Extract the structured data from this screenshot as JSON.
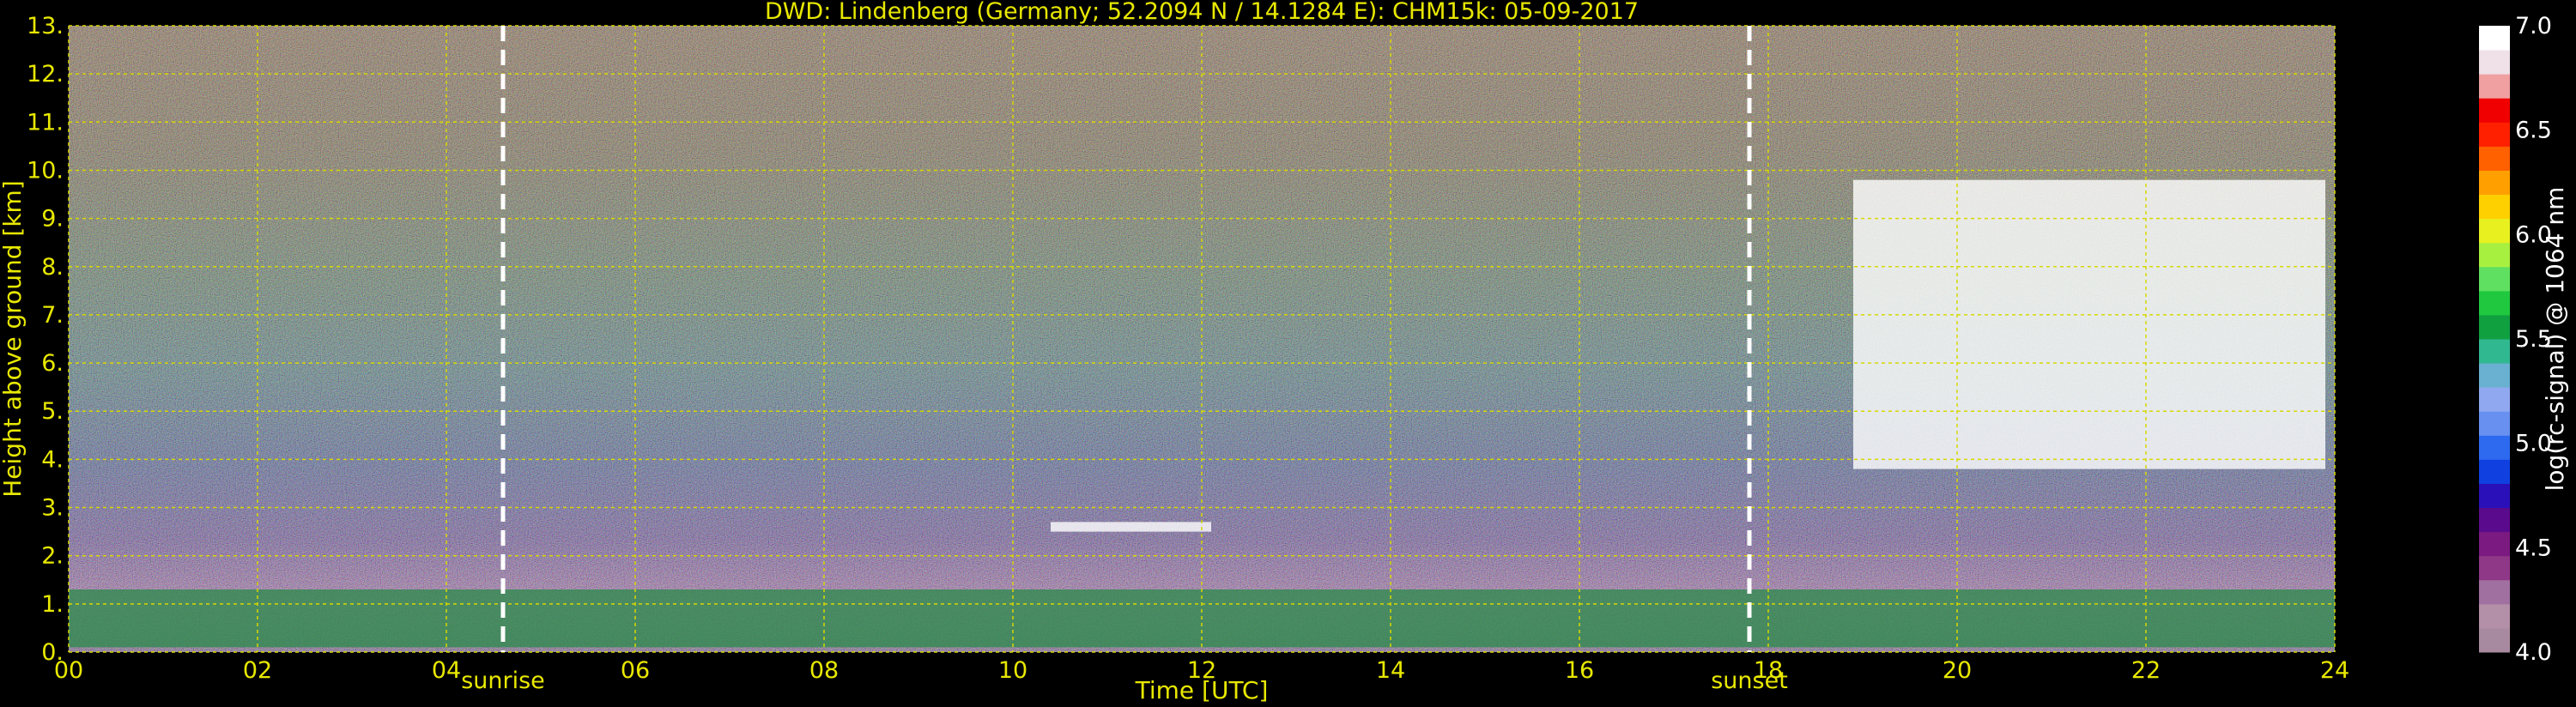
{
  "chart_data": {
    "type": "heatmap",
    "title": "DWD: Lindenberg (Germany; 52.2094 N / 14.1284 E):     CHM15k: 05-09-2017",
    "xlabel": "Time [UTC]",
    "ylabel": "Height above ground [km]",
    "xlim": [
      0,
      24
    ],
    "ylim": [
      0,
      13
    ],
    "x_ticks": [
      "00",
      "02",
      "04",
      "06",
      "08",
      "10",
      "12",
      "14",
      "16",
      "18",
      "20",
      "22",
      "24"
    ],
    "y_ticks": [
      "0.",
      "1.",
      "2.",
      "3.",
      "4.",
      "5.",
      "6.",
      "7.",
      "8.",
      "9.",
      "10.",
      "11.",
      "12.",
      "13."
    ],
    "grid": true,
    "colorbar": {
      "label": "log(rc-signal) @ 1064 nm",
      "range": [
        4.0,
        7.0
      ],
      "ticks": [
        "4.0",
        "4.5",
        "5.0",
        "5.5",
        "6.0",
        "6.5",
        "7.0"
      ],
      "colors": [
        "#a88aa0",
        "#b48fa8",
        "#a070a0",
        "#903888",
        "#7b1a80",
        "#5a0a8c",
        "#2a10b8",
        "#1040e0",
        "#2e6af0",
        "#6890f0",
        "#90a8f0",
        "#6ab0d0",
        "#30b890",
        "#10a040",
        "#20c840",
        "#60e060",
        "#a8f040",
        "#e8f020",
        "#ffd000",
        "#ffa000",
        "#ff6000",
        "#ff2000",
        "#f00000",
        "#f0a0a0",
        "#f0e0e8",
        "#ffffff"
      ]
    },
    "markers": [
      {
        "label": "sunrise",
        "x": 4.6
      },
      {
        "label": "sunset",
        "x": 17.8
      }
    ],
    "layers": [
      {
        "name": "boundary layer (near surface)",
        "x_start": 0,
        "x_end": 24,
        "y_bottom": 0.1,
        "y_top": 1.3
      },
      {
        "name": "cloud",
        "x_start": 10.4,
        "x_end": 12.1,
        "y_bottom": 2.5,
        "y_top": 2.7
      },
      {
        "name": "cloud",
        "x_start": 18.9,
        "x_end": 23.9,
        "y_bottom": 3.8,
        "y_top": 9.8
      }
    ]
  }
}
